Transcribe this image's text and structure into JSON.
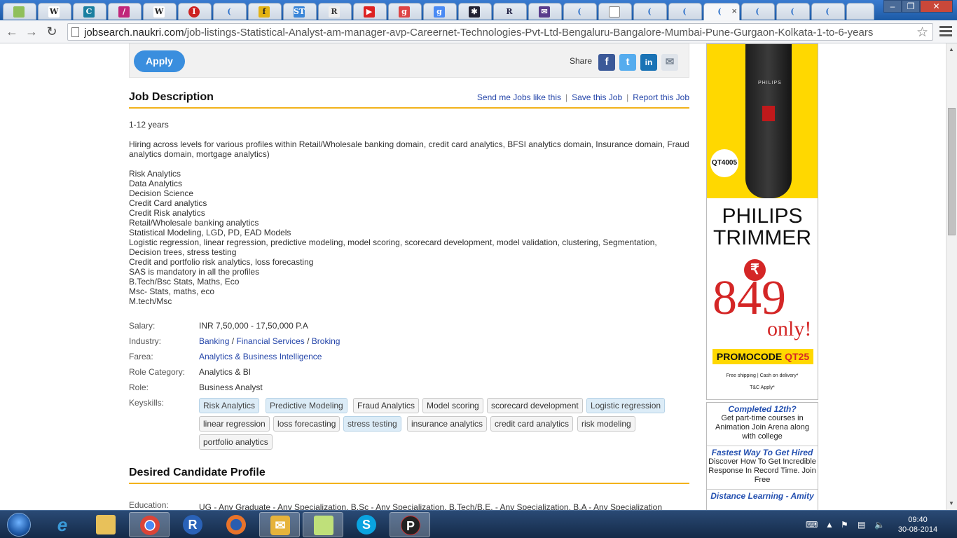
{
  "browser": {
    "active_tab_close": "×",
    "url_host": "jobsearch.naukri.com",
    "url_path": "/job-listings-Statistical-Analyst-am-manager-avp-Careernet-Technologies-Pvt-Ltd-Bengaluru-Bangalore-Mumbai-Pune-Gurgaon-Kolkata-1-to-6-years"
  },
  "top_bar": {
    "apply_label": "Apply",
    "share_label": "Share"
  },
  "job_description": {
    "title": "Job Description",
    "links": [
      "Send me Jobs like this",
      "Save this Job",
      "Report this Job"
    ],
    "experience": "1-12 years",
    "intro": "Hiring across levels for various profiles within Retail/Wholesale banking domain, credit card analytics, BFSI analytics domain, Insurance domain, Fraud analytics domain, mortgage analytics)",
    "lines": [
      "Risk Analytics",
      "Data Analytics",
      "Decision Science",
      "Credit Card analytics",
      "Credit Risk analytics",
      "Retail/Wholesale banking analytics",
      "Statistical Modeling, LGD, PD, EAD Models",
      "Logistic regression, linear regression, predictive modeling, model scoring, scorecard development, model validation, clustering, Segmentation,",
      "Decision trees, stress testing",
      "Credit and portfolio risk analytics, loss forecasting",
      "SAS is mandatory in all the profiles",
      "B.Tech/Bsc Stats, Maths, Eco",
      "Msc- Stats, maths, eco",
      "M.tech/Msc"
    ]
  },
  "details": {
    "salary_label": "Salary:",
    "salary": "INR 7,50,000 - 17,50,000 P.A",
    "industry_label": "Industry:",
    "industry": [
      "Banking",
      "Financial Services",
      "Broking"
    ],
    "farea_label": "Farea:",
    "farea": "Analytics & Business Intelligence",
    "role_category_label": "Role Category:",
    "role_category": "Analytics & BI",
    "role_label": "Role:",
    "role": "Business Analyst",
    "keyskills_label": "Keyskills:",
    "keyskills": [
      "Risk Analytics",
      "Predictive Modeling",
      "Fraud Analytics",
      "Model scoring",
      "scorecard development",
      "Logistic regression",
      "linear regression",
      "loss forecasting",
      "stress testing",
      "insurance analytics",
      "credit card analytics",
      "risk modeling",
      "portfolio analytics"
    ]
  },
  "desired_profile": {
    "title": "Desired Candidate Profile",
    "education_label": "Education:",
    "education": "UG - Any Graduate - Any Specialization, B.Sc - Any Specialization, B.Tech/B.E. - Any Specialization, B.A - Any Specialization"
  },
  "ads": {
    "banner": {
      "brand": "PHILIPS",
      "model": "QT4005",
      "line1": "PHILIPS",
      "line2": "TRIMMER",
      "rupee": "₹",
      "price": "849",
      "only": "only!",
      "promo_prefix": "PROMOCODE ",
      "promo_code": "QT25",
      "shipping": "Free shipping | Cash on delivery*",
      "tc": "T&C Apply*"
    },
    "text_ads": [
      {
        "heading": "Completed 12th?",
        "body": "Get part-time courses in Animation Join Arena along with college"
      },
      {
        "heading": "Fastest Way To Get Hired",
        "body": "Discover How To Get Incredible Response In Record Time. Join Free"
      },
      {
        "heading": "Distance Learning - Amity",
        "body": ""
      }
    ]
  },
  "taskbar": {
    "time": "09:40",
    "date": "30-08-2014"
  }
}
